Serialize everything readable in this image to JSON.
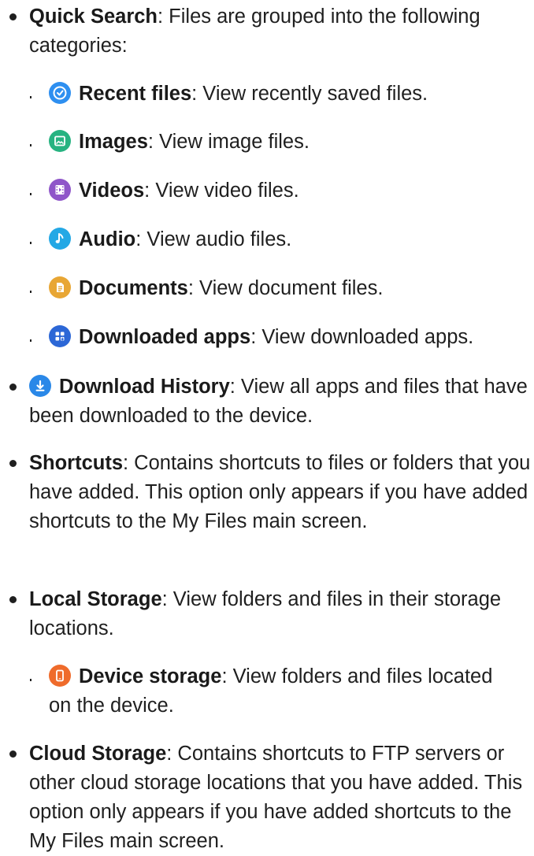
{
  "items": {
    "quick_search": {
      "title": "Quick Search",
      "text": ": Files are grouped into the following categories:"
    },
    "recent_files": {
      "title": "Recent files",
      "text": ": View recently saved files."
    },
    "images": {
      "title": "Images",
      "text": ": View image files."
    },
    "videos": {
      "title": "Videos",
      "text": ": View video files."
    },
    "audio": {
      "title": "Audio",
      "text": ": View audio files."
    },
    "documents": {
      "title": "Documents",
      "text": ": View document files."
    },
    "downloaded_apps": {
      "title": "Downloaded apps",
      "text": ": View downloaded apps."
    },
    "download_history": {
      "title": "Download History",
      "text": ": View all apps and files that have been downloaded to the device."
    },
    "shortcuts": {
      "title": "Shortcuts",
      "text": ": Contains shortcuts to files or folders that you have added. This option only appears if you have added shortcuts to the My Files main screen."
    },
    "local_storage": {
      "title": "Local Storage",
      "text": ": View folders and files in their storage locations."
    },
    "device_storage": {
      "title": "Device storage",
      "text": ": View folders and files located on the device."
    },
    "cloud_storage": {
      "title": "Cloud Storage",
      "text": ": Contains shortcuts to FTP servers or other cloud storage locations that you have added. This option only appears if you have added shortcuts to the My Files main screen."
    }
  },
  "icons": {
    "recent_files": "clock-icon",
    "images": "image-icon",
    "videos": "video-icon",
    "audio": "music-note-icon",
    "documents": "document-icon",
    "downloaded_apps": "apps-icon",
    "download_history": "download-icon",
    "device_storage": "phone-icon"
  },
  "colors": {
    "recent_files": "#2e8ff0",
    "images": "#27b381",
    "videos": "#8f56c9",
    "audio": "#23a8e5",
    "documents": "#e8a634",
    "downloaded_apps": "#2c67d6",
    "download_history": "#2a88e8",
    "device_storage": "#ef6b2b"
  }
}
